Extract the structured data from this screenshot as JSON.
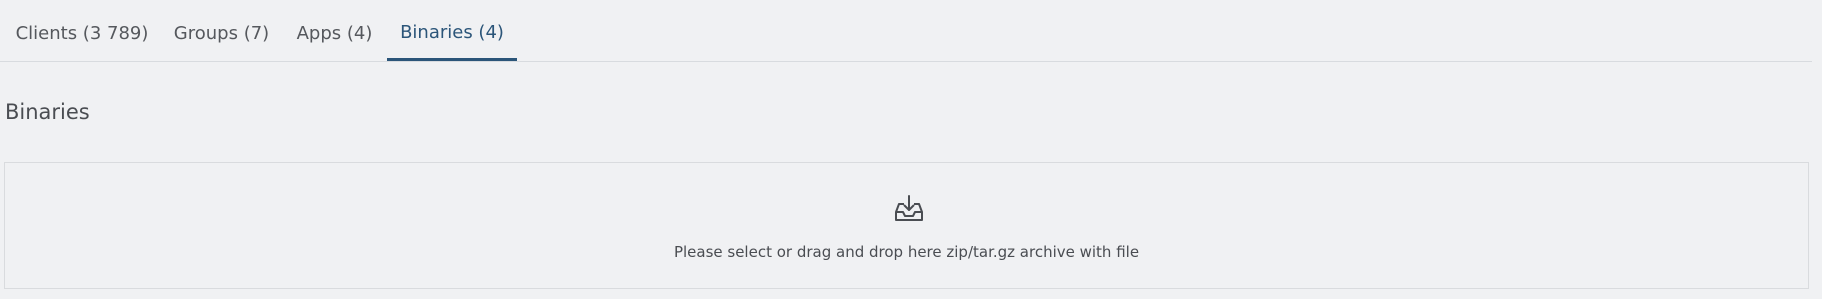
{
  "tabs": [
    {
      "label": "Clients (3 789)",
      "active": false
    },
    {
      "label": "Groups (7)",
      "active": false
    },
    {
      "label": "Apps (4)",
      "active": false
    },
    {
      "label": "Binaries (4)",
      "active": true
    }
  ],
  "section": {
    "title": "Binaries"
  },
  "dropzone": {
    "icon": "download-tray-icon",
    "text": "Please select or drag and drop here zip/tar.gz archive with file"
  },
  "colors": {
    "background": "#f0f1f3",
    "active_tab": "#2b5579",
    "border": "#d9dbde"
  }
}
